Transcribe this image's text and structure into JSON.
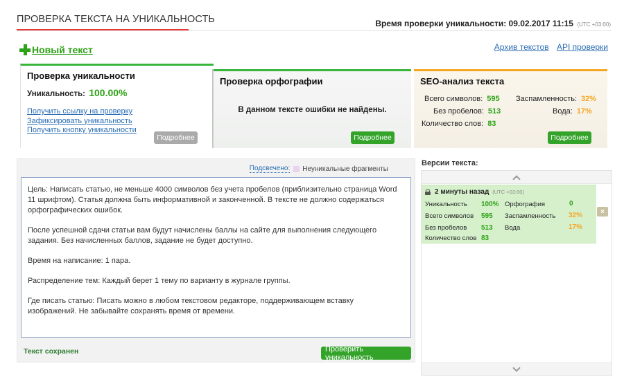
{
  "header": {
    "title": "ПРОВЕРКА ТЕКСТА НА УНИКАЛЬНОСТЬ",
    "check_time_label": "Время проверки уникальности: 09.02.2017 11:15",
    "timezone": "(UTC +03:00)"
  },
  "actions": {
    "new_text": "Новый текст",
    "archive_link": "Архив текстов",
    "api_link": "API проверки"
  },
  "uniqueness_card": {
    "title": "Проверка уникальности",
    "label": "Уникальность:",
    "value": "100.00%",
    "links": [
      "Получить ссылку на проверку",
      "Зафиксировать уникальность",
      "Получить кнопку уникальности"
    ],
    "more_button": "Подробнее"
  },
  "spelling_card": {
    "title": "Проверка орфографии",
    "message": "В данном тексте ошибки не найдены.",
    "more_button": "Подробнее"
  },
  "seo_card": {
    "title": "SEO-анализ текста",
    "total_chars_label": "Всего символов:",
    "total_chars": "595",
    "no_spaces_label": "Без пробелов:",
    "no_spaces": "513",
    "words_label": "Количество слов:",
    "words": "83",
    "spam_label": "Заспамленность:",
    "spam": "32%",
    "water_label": "Вода:",
    "water": "17%",
    "more_button": "Подробнее"
  },
  "editor": {
    "highlight_link": "Подсвечено:",
    "highlight_legend": "Неуникальные фрагменты",
    "paragraphs": [
      "Цель: Написать статью, не меньше 4000 символов без учета пробелов (приблизительно страница Word 11 шрифтом). Статья должна быть информативной и законченной. В тексте не должно содержаться орфографических ошибок.",
      "После успешной сдачи статьи вам будут начислены баллы на сайте для выполнения следующего задания. Без начисленных баллов, задание не будет доступно.",
      "Время на написание: 1 пара.",
      "Распределение тем: Каждый берет 1 тему по варианту в журнале группы.",
      "Где писать статью: Писать можно в любом текстовом редакторе, поддерживающем вставку изображений. Не забывайте сохранять время от времени."
    ],
    "saved_status": "Текст сохранен",
    "check_button": "Проверить уникальность"
  },
  "versions": {
    "title": "Версии текста:",
    "items": [
      {
        "time": "2 минуты назад",
        "timezone": "(UTC +03:00)",
        "uniq_label": "Уникальность",
        "uniq": "100%",
        "spell_label": "Орфография",
        "spell": "0",
        "total_label": "Всего символов",
        "total": "595",
        "spam_label": "Заспамленность",
        "spam": "32%",
        "nospace_label": "Без пробелов",
        "nospace": "513",
        "water_label": "Вода",
        "water": "17%",
        "words_label": "Количество слов",
        "words": "83",
        "close": "×"
      }
    ]
  },
  "colors": {
    "accent_green": "#2ea317",
    "link_blue": "#2a6db4",
    "title_underline_red": "#e53935",
    "seo_orange": "#f5a623"
  }
}
